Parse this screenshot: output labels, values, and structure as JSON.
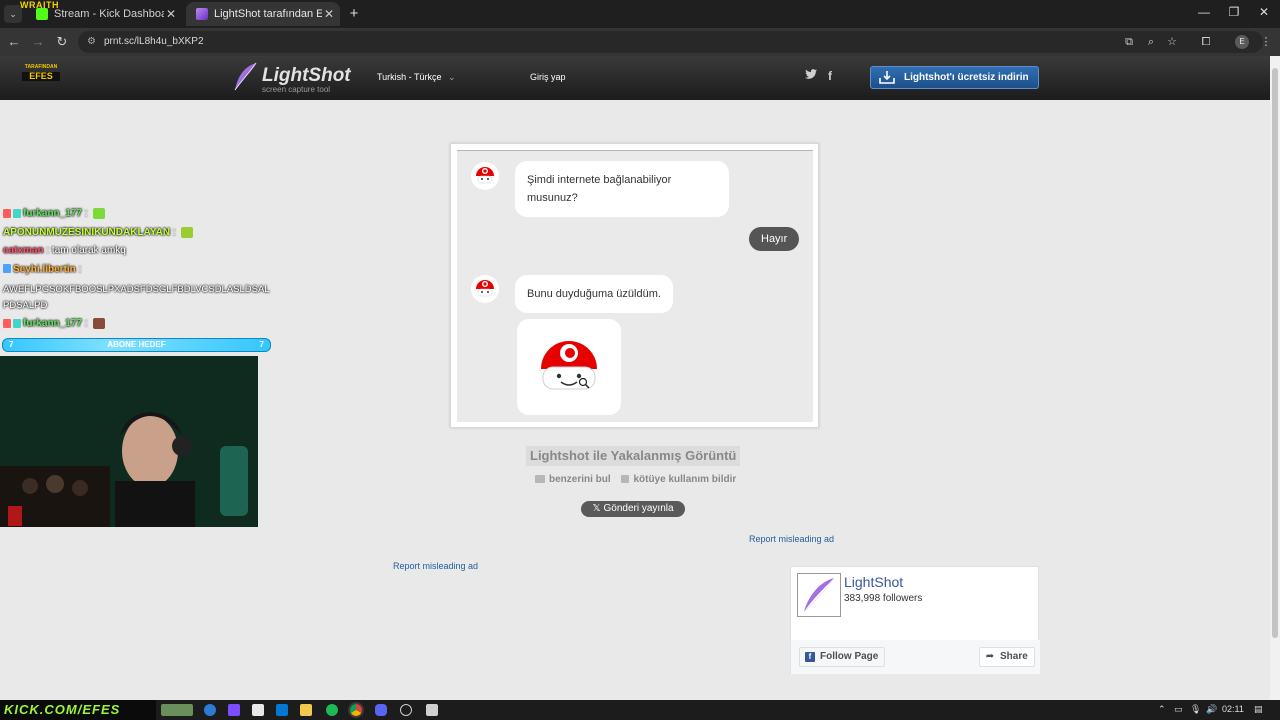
{
  "browser": {
    "tabs": [
      {
        "title": "Stream - Kick Dashboard",
        "close": "✕"
      },
      {
        "title": "LightShot tarafından Ekran Görüntüsü",
        "close": "✕"
      }
    ],
    "new_tab": "+",
    "url": "prnt.sc/lL8h4u_bXKP2",
    "window_controls": {
      "minimize": "—",
      "restore": "❐",
      "close": "✕"
    },
    "profile_initial": "E"
  },
  "overlay": {
    "wraith": "WRAITH",
    "efes_logo_line1": "TARAFINDAN",
    "efes_logo_line2": "EFES",
    "chat": [
      {
        "user": "furkann_177",
        "sep": " : ",
        "message": ""
      },
      {
        "user": "APONUNMUZESINIKUNDAKLAYAN",
        "sep": " : ",
        "message": ""
      },
      {
        "user": "catxman",
        "sep": " : ",
        "message": "tam olarak amkq"
      },
      {
        "user": "Seyhi.libertin",
        "sep": " : ",
        "message": "AWEFLPGSOKFBOOSLPXADSFDSGLFBDLVCSDLASLDSALPDSALPD"
      },
      {
        "user": "furkann_177",
        "sep": " : ",
        "message": ""
      }
    ],
    "sub_goal": {
      "label": "ABONE HEDEF",
      "left": "7",
      "right": "7"
    },
    "banner": "KICK.COM/EFES"
  },
  "lightshot": {
    "logo_text": "LightShot",
    "logo_sub": "screen capture tool",
    "language": "Turkish - Türkçe",
    "language_caret": "⌄",
    "login": "Giriş yap",
    "twitter": "𝕥",
    "facebook": "f",
    "download_button": "Lightshot'ı ücretsiz indirin",
    "screenshot": {
      "bot_q1": "Şimdi internete bağlanabiliyor musunuz?",
      "user_reply": "Hayır",
      "bot_a2": "Bunu duyduğuma üzüldüm."
    },
    "capture_title": "Lightshot ile Yakalanmış Görüntü",
    "find_similar": "benzerini bul",
    "report_abuse": "kötüye kullanım bildir",
    "tweet_button": "Gönderi yayınla",
    "report_ad_right": "Report misleading ad",
    "report_ad_left": "Report misleading ad",
    "facebook_widget": {
      "name": "LightShot",
      "followers": "383,998 followers",
      "follow": "Follow Page",
      "share": "Share"
    }
  },
  "taskbar": {
    "time": "02:11"
  },
  "colors": {
    "accent_blue": "#2f6fb3",
    "header_dark": "#1c1c1c",
    "vodafone_red": "#e60000",
    "kick_green": "#53fc18"
  }
}
